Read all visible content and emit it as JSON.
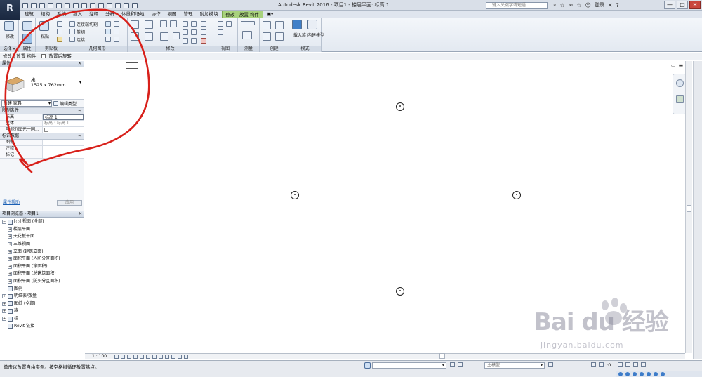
{
  "window": {
    "app_button_label": "R",
    "title": "Autodesk Revit 2016 -   项目1 - 楼层平面: 标高 1",
    "search_placeholder": "键入关键字或短语",
    "login": "登录",
    "minimize": "—",
    "maximize": "□",
    "close": "✕"
  },
  "ribbon_tabs": [
    "建筑",
    "结构",
    "系统",
    "插入",
    "注释",
    "分析",
    "体量和场地",
    "协作",
    "视图",
    "管理",
    "附加模块",
    "修改 | 放置 构件",
    "▣▾"
  ],
  "ribbon": {
    "modify_label": "修改",
    "paste_label": "粘贴",
    "join_cut": "连接端切割",
    "cut": "剪切",
    "join": "连接",
    "load_family": "载入族",
    "inplace_model": "内建模型",
    "panels": {
      "select": "选择 ▾",
      "properties": "属性",
      "clipboard": "剪贴板",
      "geometry": "几何图形",
      "modify": "修改",
      "view": "视图",
      "measure": "测量",
      "create": "创建",
      "mode": "模式"
    }
  },
  "context_bar": {
    "text": "修改 | 放置 构件",
    "checkbox_label": "放置后旋转"
  },
  "properties": {
    "header": "属性",
    "type_name": "桌",
    "type_size": "1525 x 762mm",
    "filter_value": "新建 家具",
    "edit_type": "编辑类型",
    "section_constraints": "限制条件",
    "section_identity": "标识数据",
    "rows_constraints": [
      {
        "key": "标高",
        "value": "标高 1"
      },
      {
        "key": "主体",
        "value": "标高 : 标高 1"
      },
      {
        "key": "与邻近图元一同...",
        "value": ""
      }
    ],
    "rows_identity": [
      {
        "key": "图像",
        "value": ""
      },
      {
        "key": "注释",
        "value": ""
      },
      {
        "key": "标记",
        "value": ""
      }
    ],
    "help_link": "属性帮助",
    "apply": "应用"
  },
  "browser": {
    "header": "项目浏览器 - 项目1",
    "items": [
      {
        "label": "[○] 视图 (全部)",
        "level": 0,
        "exp": "−"
      },
      {
        "label": "楼层平面",
        "level": 1,
        "exp": "+"
      },
      {
        "label": "天花板平面",
        "level": 1,
        "exp": "+"
      },
      {
        "label": "三维视图",
        "level": 1,
        "exp": "+"
      },
      {
        "label": "立面 (建筑立面)",
        "level": 1,
        "exp": "+"
      },
      {
        "label": "面积平面 (人防分区面积)",
        "level": 1,
        "exp": "+"
      },
      {
        "label": "面积平面 (净面积)",
        "level": 1,
        "exp": "+"
      },
      {
        "label": "面积平面 (总建筑面积)",
        "level": 1,
        "exp": "+"
      },
      {
        "label": "面积平面 (防火分区面积)",
        "level": 1,
        "exp": "+"
      },
      {
        "label": "图例",
        "level": 0,
        "exp": ""
      },
      {
        "label": "明细表/数量",
        "level": 0,
        "exp": "+"
      },
      {
        "label": "图纸 (全部)",
        "level": 0,
        "exp": "+"
      },
      {
        "label": "族",
        "level": 0,
        "exp": "+"
      },
      {
        "label": "组",
        "level": 0,
        "exp": "+"
      },
      {
        "label": "Revit 链接",
        "level": 0,
        "exp": ""
      }
    ]
  },
  "view_control": {
    "scale": "1 : 100"
  },
  "status": {
    "text": "单击以放置自由实例。按空格键循环放置基点。",
    "workset_value": ":0",
    "design_option": "主模型",
    "filter_value": ":0"
  },
  "watermark": {
    "logo": "Bai du 经验",
    "url": "jingyan.baidu.com"
  }
}
